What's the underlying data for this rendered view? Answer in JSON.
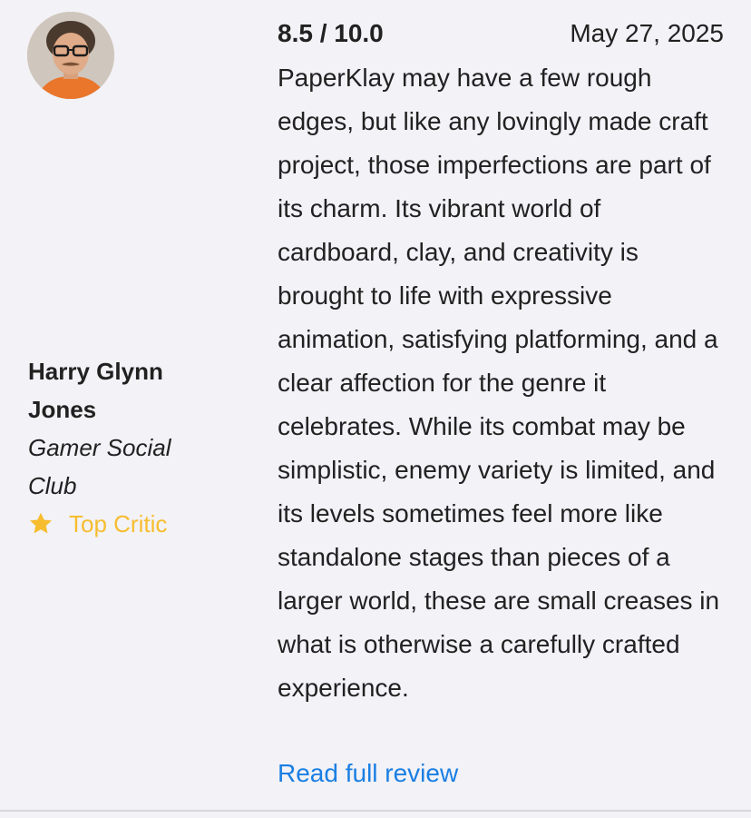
{
  "review": {
    "author": {
      "name": "Harry Glynn Jones",
      "outlet": "Gamer Social Club",
      "badge": "Top Critic"
    },
    "score": "8.5 / 10.0",
    "date": "May 27, 2025",
    "text": "PaperKlay may have a few rough edges, but like any lovingly made craft project, those imperfections are part of its charm. Its vibrant world of cardboard, clay, and creativity is brought to life with expressive animation, satisfying platforming, and a clear affection for the genre it celebrates. While its combat may be simplistic, enemy variety is limited, and its levels sometimes feel more like standalone stages than pieces of a larger world, these are small creases in what is otherwise a carefully crafted experience.",
    "read_more_label": "Read full review"
  },
  "colors": {
    "background": "#f2f2f7",
    "text": "#212121",
    "badge": "#f7bd2f",
    "link": "#1a7fe3",
    "divider": "#d6d6dc"
  },
  "icons": {
    "badge": "star-icon",
    "avatar": "author-avatar-photo"
  }
}
